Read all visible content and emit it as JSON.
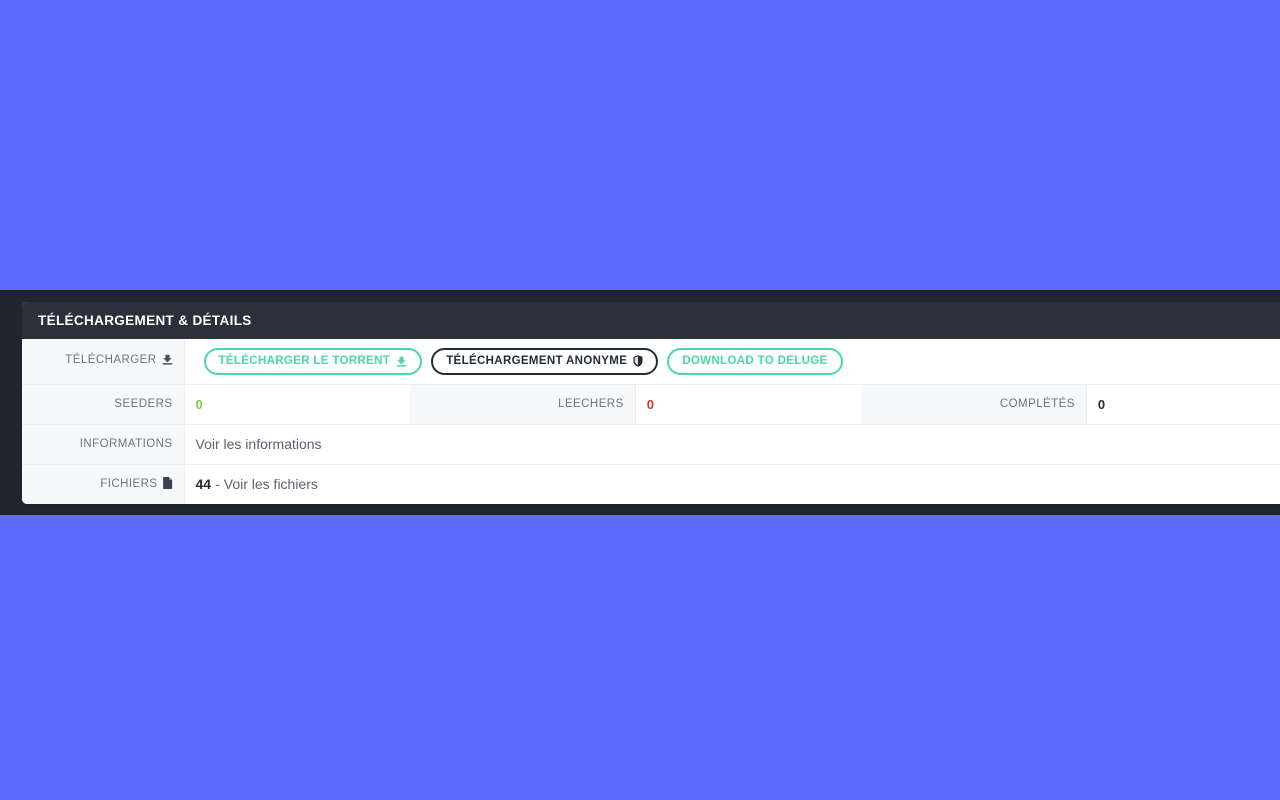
{
  "theme": {
    "page_background": "#5d6bfb",
    "strip_background": "#21262e",
    "panel_header_background": "#2b313b",
    "accent_green": "#4ad9a4",
    "accent_dark": "#262c36",
    "label_background": "#f7f8f9",
    "seeders_color": "#8dc63f",
    "leechers_color": "#d0342c",
    "completed_color": "#262c36"
  },
  "panel": {
    "header_title": "TÉLÉCHARGEMENT & DÉTAILS"
  },
  "rows": {
    "download": {
      "label": "TÉLÉCHARGER",
      "label_icon": "download-icon",
      "buttons": [
        {
          "label": "TÉLÉCHARGER LE TORRENT",
          "icon": "download-icon",
          "style": "green"
        },
        {
          "label": "TÉLÉCHARGEMENT ANONYME",
          "icon": "shield-icon",
          "style": "dark"
        },
        {
          "label": "DOWNLOAD TO DELUGE",
          "icon": "none",
          "style": "green"
        }
      ]
    },
    "stats": {
      "seeders_label": "SEEDERS",
      "seeders_value": "0",
      "leechers_label": "LEECHERS",
      "leechers_value": "0",
      "completed_label": "COMPLÉTÉS",
      "completed_value": "0"
    },
    "informations": {
      "label": "INFORMATIONS",
      "link_text": "Voir les informations"
    },
    "files": {
      "label": "FICHIERS",
      "label_icon": "file-icon",
      "count": "44",
      "separator": "-",
      "link_text": "Voir les fichiers"
    }
  }
}
